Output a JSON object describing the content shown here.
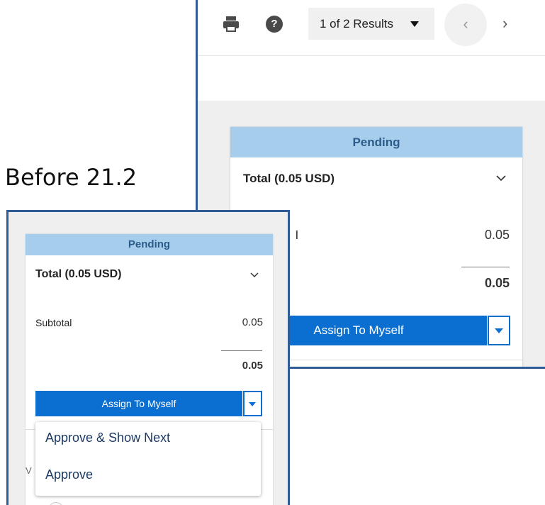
{
  "caption": "Before 21.2",
  "after": {
    "toolbar": {
      "print_icon": "printer-icon",
      "help_icon": "help-icon",
      "help_glyph": "?",
      "results_label": "1 of 2 Results",
      "prev_glyph": "‹",
      "next_glyph": "›"
    },
    "card": {
      "status": "Pending",
      "total_label": "Total (0.05 USD)",
      "subtotal_label_fragment": "l",
      "subtotal_value": "0.05",
      "sum_value": "0.05",
      "assign_label": "Assign To Myself"
    }
  },
  "before": {
    "card": {
      "status": "Pending",
      "total_label": "Total (0.05 USD)",
      "subtotal_label": "Subtotal",
      "subtotal_value": "0.05",
      "sum_value": "0.05",
      "assign_label": "Assign To Myself",
      "hidden_letter": "V"
    },
    "menu": {
      "items": [
        "Approve & Show Next",
        "Approve"
      ]
    }
  },
  "colors": {
    "panel_border": "#2f5b96",
    "status_bg": "#a6cdeb",
    "primary": "#0a6fd0"
  }
}
